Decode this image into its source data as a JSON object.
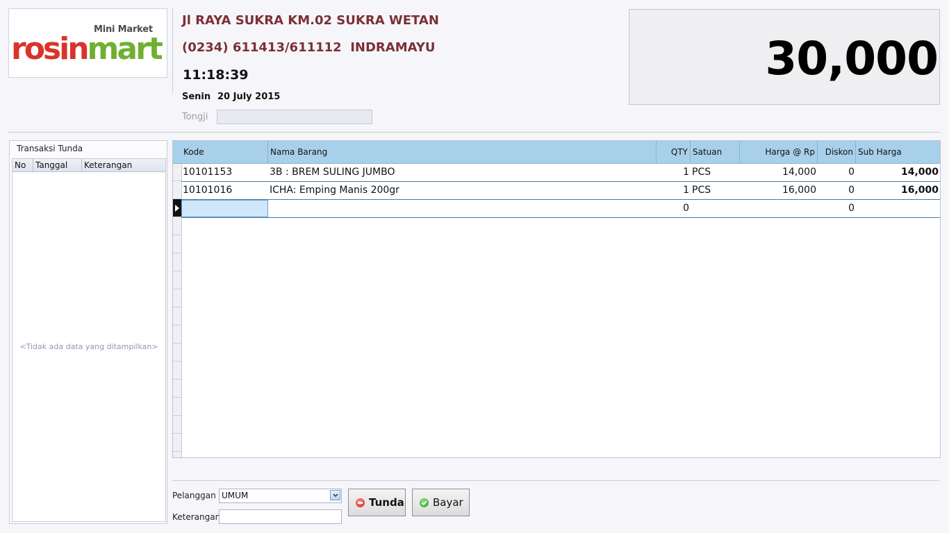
{
  "logo": {
    "subtitle": "Mini Market",
    "part_red": "rosin",
    "part_green": "mart"
  },
  "header": {
    "address": "Jl RAYA SUKRA KM.02 SUKRA WETAN",
    "phone": "(0234) 611413/611112  INDRAMAYU",
    "time": "11:18:39",
    "day": "Senin",
    "date": "20 July 2015",
    "tongji_label": "Tongji",
    "tongji_value": ""
  },
  "total": {
    "value": "30,000"
  },
  "pending": {
    "title": "Transaksi Tunda",
    "columns": [
      "No",
      "Tanggal",
      "Keterangan"
    ],
    "empty_text": "<Tidak ada data yang ditampilkan>"
  },
  "grid": {
    "columns": {
      "kode": "Kode",
      "nama": "Nama Barang",
      "qty": "QTY",
      "satuan": "Satuan",
      "harga": "Harga @ Rp",
      "diskon": "Diskon",
      "sub": "Sub Harga"
    },
    "rows": [
      {
        "kode": "10101153",
        "nama": "3B : BREM SULING JUMBO",
        "qty": "1",
        "satuan": "PCS",
        "harga": "14,000",
        "diskon": "0",
        "sub": "14,000"
      },
      {
        "kode": "10101016",
        "nama": "ICHA: Emping Manis 200gr",
        "qty": "1",
        "satuan": "PCS",
        "harga": "16,000",
        "diskon": "0",
        "sub": "16,000"
      },
      {
        "kode": "",
        "nama": "",
        "qty": "0",
        "satuan": "",
        "harga": "",
        "diskon": "0",
        "sub": ""
      }
    ]
  },
  "form": {
    "pelanggan_label": "Pelanggan",
    "pelanggan_value": "UMUM",
    "keterangan_label": "Keterangan",
    "keterangan_value": ""
  },
  "buttons": {
    "tunda": "Tunda",
    "bayar": "Bayar"
  },
  "colors": {
    "header_text": "#7a3036",
    "grid_header": "#a8d0ea",
    "logo_red": "#d9332b",
    "logo_green": "#6fb030"
  }
}
